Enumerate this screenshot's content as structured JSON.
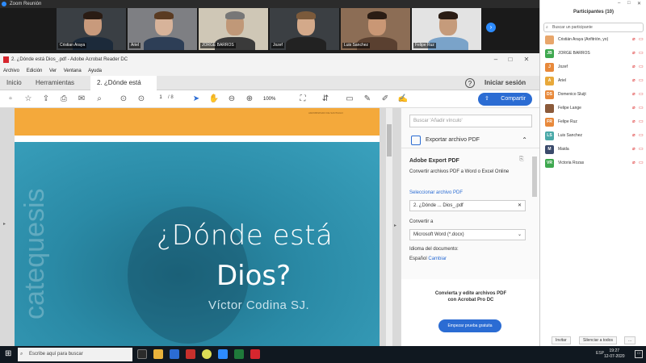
{
  "zoom": {
    "title": "Zoom Reunión"
  },
  "video_tiles": [
    {
      "name": "Cristian Araya"
    },
    {
      "name": "Ariel"
    },
    {
      "name": "JORGE BARROS"
    },
    {
      "name": "Jozef"
    },
    {
      "name": "Luis Sanchez"
    },
    {
      "name": "Felipe Ruz"
    }
  ],
  "acrobat": {
    "window_title": "2. ¿Dónde está Dios_.pdf - Adobe Acrobat Reader DC",
    "menu": [
      "Archivo",
      "Edición",
      "Ver",
      "Ventana",
      "Ayuda"
    ],
    "tabs": {
      "home": "Inicio",
      "tools": "Herramientas",
      "doc": "2. ¿Dónde está Dio..."
    },
    "signin": "Iniciar sesión",
    "share": "Compartir",
    "page_current": "1",
    "page_total": "/ 8",
    "zoom_level": "100%"
  },
  "document": {
    "title_line1": "¿Dónde está",
    "title_line2": "Dios?",
    "author": "Víctor Codina SJ.",
    "vertical_text": "catequesis",
    "logo_text": "ARZOBISPADO DE SANTIAGO"
  },
  "panel": {
    "search_placeholder": "Buscar 'Añadir vínculo'",
    "section": "Exportar archivo PDF",
    "heading": "Adobe Export PDF",
    "desc": "Convertir archivos PDF a Word o Excel Online",
    "select_label": "Seleccionar archivo PDF",
    "file": "2. ¿Dónde ... Dios_.pdf",
    "convert_label": "Convertir a",
    "convert_value": "Microsoft Word (*.docx)",
    "lang_label": "Idioma del documento:",
    "lang_value": "Español",
    "lang_change": "Cambiar",
    "promo_line1": "Convierta y edite archivos PDF",
    "promo_line2": "con Acrobat Pro DC",
    "promo_button": "Empezar prueba gratuita"
  },
  "participants": {
    "header": "Participantes (10)",
    "search_placeholder": "Buscar un participante",
    "list": [
      {
        "initials": "",
        "name": "Cristián Araya (Anfitrión, yo)",
        "color": "#e8a66b"
      },
      {
        "initials": "JB",
        "name": "JORGE BARROS",
        "color": "#3ea84f"
      },
      {
        "initials": "J",
        "name": "Jozef",
        "color": "#e8893b"
      },
      {
        "initials": "A",
        "name": "Ariel",
        "color": "#e8a93b"
      },
      {
        "initials": "DS",
        "name": "Domenico Sluijt",
        "color": "#e8893b"
      },
      {
        "initials": "",
        "name": "Felipe Lange",
        "color": "#8b5a3a"
      },
      {
        "initials": "FR",
        "name": "Felipe Ruz",
        "color": "#e8893b"
      },
      {
        "initials": "LS",
        "name": "Luis Sanchez",
        "color": "#4aa9a8"
      },
      {
        "initials": "M",
        "name": "Maida",
        "color": "#3a4a6b"
      },
      {
        "initials": "VR",
        "name": "Victoria Rozas",
        "color": "#3ea84f"
      }
    ],
    "invite": "Invitar",
    "mute_all": "Silenciar a todos",
    "more": "..."
  },
  "taskbar": {
    "search": "Escribe aquí para buscar",
    "time": "19:27",
    "date": "12-07-2020",
    "lang": "ESP"
  }
}
